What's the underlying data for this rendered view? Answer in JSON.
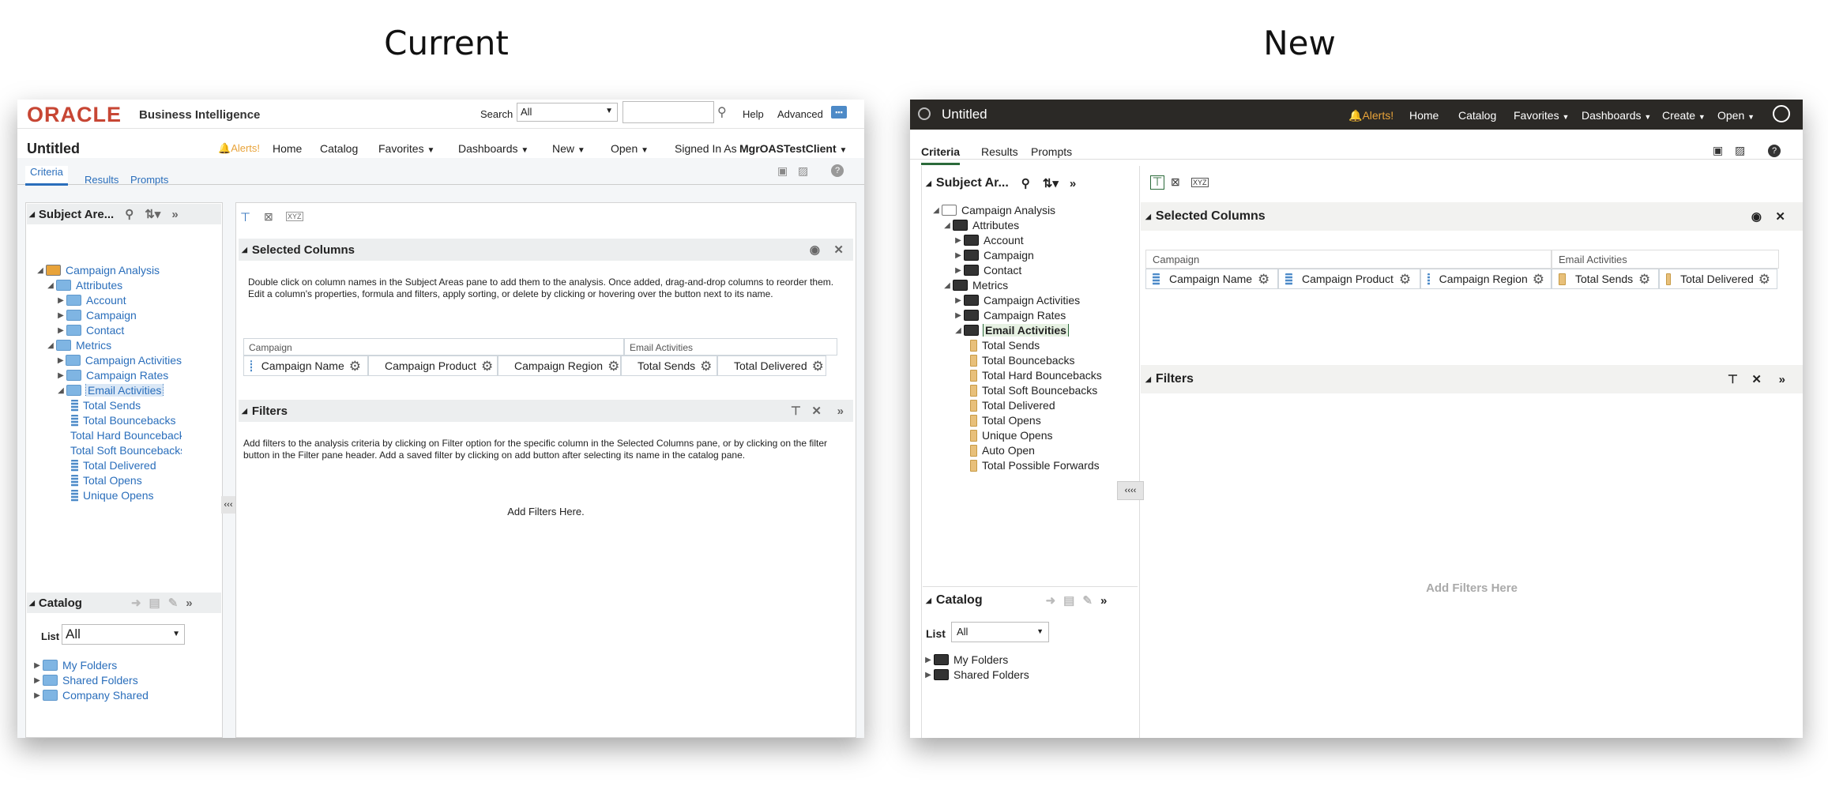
{
  "headings": {
    "current": "Current",
    "new": "New"
  },
  "current": {
    "brand": {
      "logo": "ORACLE",
      "product": "Business Intelligence"
    },
    "search": {
      "label": "Search",
      "scope": "All",
      "value": ""
    },
    "top_links": {
      "help": "Help",
      "advanced": "Advanced"
    },
    "title": "Untitled",
    "nav": {
      "alerts": "Alerts!",
      "home": "Home",
      "catalog": "Catalog",
      "favorites": "Favorites",
      "dashboards": "Dashboards",
      "new": "New",
      "open": "Open",
      "signed_in_label": "Signed In As",
      "user": "MgrOASTestClient"
    },
    "tabs": [
      "Criteria",
      "Results",
      "Prompts"
    ],
    "subject_areas": {
      "title": "Subject Are...",
      "tree": [
        "Campaign Analysis",
        "Attributes",
        "Account",
        "Campaign",
        "Contact",
        "Metrics",
        "Campaign Activities",
        "Campaign Rates",
        "Email Activities",
        "Total Sends",
        "Total Bouncebacks",
        "Total Hard Bouncebacks",
        "Total Soft Bouncebacks",
        "Total Delivered",
        "Total Opens",
        "Unique Opens"
      ]
    },
    "catalog": {
      "title": "Catalog",
      "list_label": "List",
      "list_value": "All",
      "folders": [
        "My Folders",
        "Shared Folders",
        "Company Shared"
      ]
    },
    "selected_columns": {
      "title": "Selected Columns",
      "help": "Double click on column names in the Subject Areas pane to add them to the analysis. Once added, drag-and-drop columns to reorder them. Edit a column's properties, formula and filters, apply sorting, or delete by clicking or hovering over the button next to its name.",
      "groups": [
        "Campaign",
        "Email Activities"
      ],
      "columns": [
        "Campaign Name",
        "Campaign Product",
        "Campaign Region",
        "Total Sends",
        "Total Delivered"
      ]
    },
    "filters": {
      "title": "Filters",
      "help": "Add filters to the analysis criteria by clicking on Filter option for the specific column in the Selected Columns pane, or by clicking on the filter button in the Filter pane header. Add a saved filter by clicking on add button after selecting its name in the catalog pane.",
      "empty": "Add Filters Here."
    }
  },
  "new": {
    "title": "Untitled",
    "nav": {
      "alerts": "Alerts!",
      "home": "Home",
      "catalog": "Catalog",
      "favorites": "Favorites",
      "dashboards": "Dashboards",
      "create": "Create",
      "open": "Open"
    },
    "tabs": [
      "Criteria",
      "Results",
      "Prompts"
    ],
    "subject_areas": {
      "title": "Subject Ar...",
      "tree": [
        "Campaign Analysis",
        "Attributes",
        "Account",
        "Campaign",
        "Contact",
        "Metrics",
        "Campaign Activities",
        "Campaign Rates",
        "Email Activities",
        "Total Sends",
        "Total Bouncebacks",
        "Total Hard Bouncebacks",
        "Total Soft Bouncebacks",
        "Total Delivered",
        "Total Opens",
        "Unique Opens",
        "Auto Open",
        "Total Possible Forwards"
      ]
    },
    "catalog": {
      "title": "Catalog",
      "list_label": "List",
      "list_value": "All",
      "folders": [
        "My Folders",
        "Shared Folders"
      ]
    },
    "selected_columns": {
      "title": "Selected Columns",
      "groups": [
        "Campaign",
        "Email Activities"
      ],
      "columns": [
        "Campaign Name",
        "Campaign Product",
        "Campaign Region",
        "Total Sends",
        "Total Delivered"
      ]
    },
    "filters": {
      "title": "Filters",
      "empty": "Add Filters Here"
    }
  },
  "colors": {
    "oracle_red": "#c74634",
    "link_blue": "#2a6ebb",
    "dark_bar": "#2b2926",
    "alert_orange": "#e8a33a"
  }
}
